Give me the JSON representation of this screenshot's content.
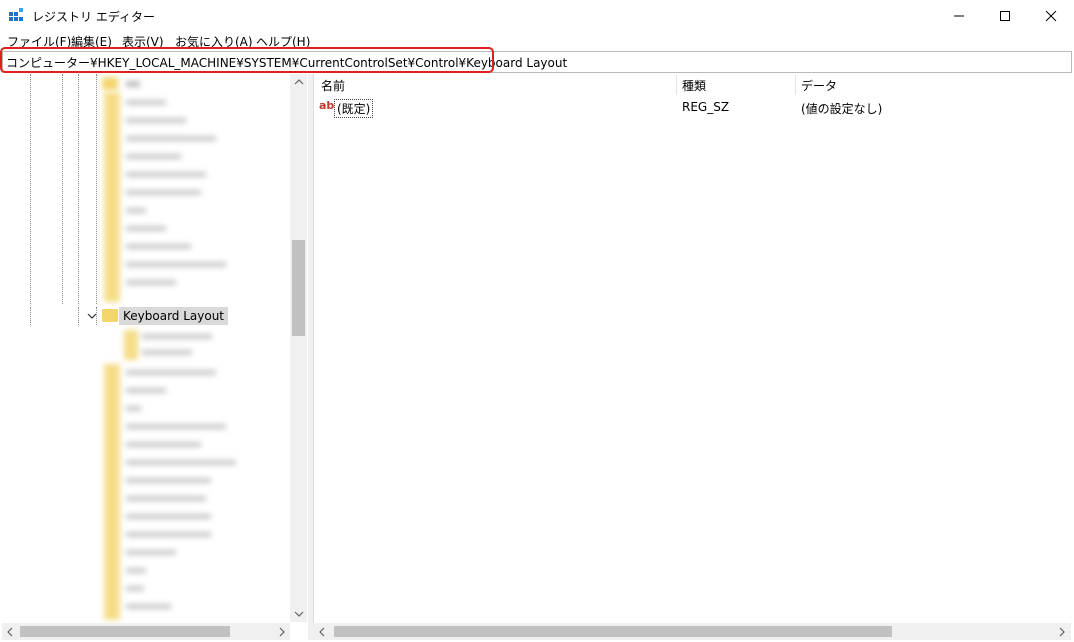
{
  "window": {
    "title": "レジストリ エディター"
  },
  "menu": [
    "ファイル(F)",
    "編集(E)",
    "表示(V)",
    "お気に入り(A)",
    "ヘルプ(H)"
  ],
  "address": "コンピューター¥HKEY_LOCAL_MACHINE¥SYSTEM¥CurrentControlSet¥Control¥Keyboard Layout",
  "tree": {
    "selected": "Keyboard Layout"
  },
  "list": {
    "columns": [
      "名前",
      "種類",
      "データ"
    ],
    "rows": [
      {
        "name": "(既定)",
        "type": "REG_SZ",
        "data": "(値の設定なし)"
      }
    ]
  },
  "colors": {
    "accent_highlight": "#e02020",
    "folder": "#f3d56e"
  }
}
